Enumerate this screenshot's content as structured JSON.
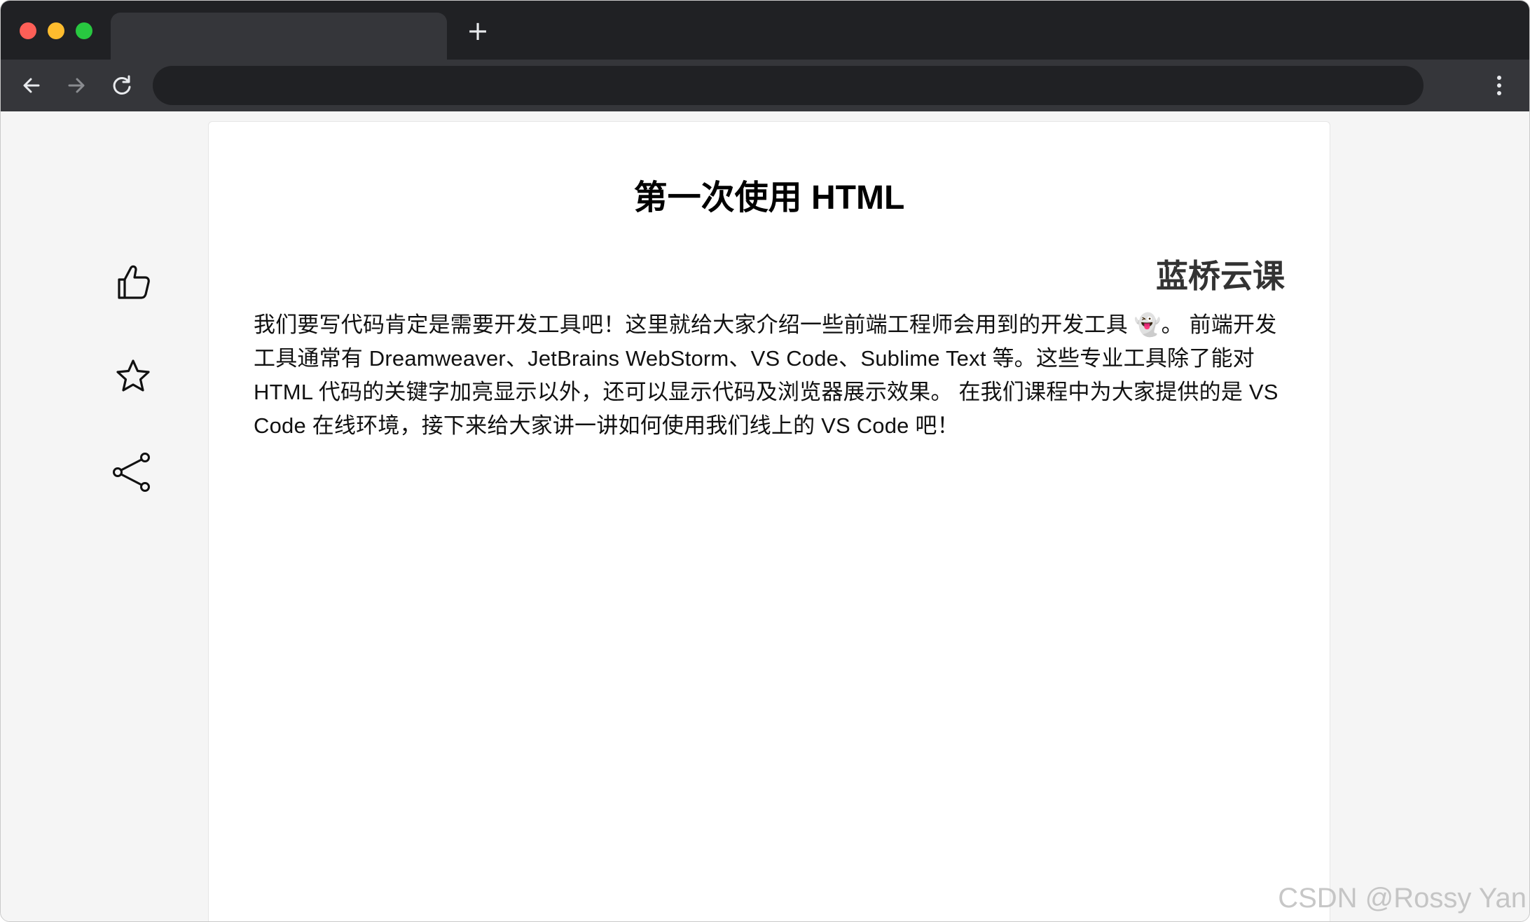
{
  "browser": {
    "new_tab_label": "+",
    "icons": {
      "back": "arrow-left-icon",
      "forward": "arrow-right-icon",
      "reload": "reload-icon",
      "menu": "more-vertical-icon"
    },
    "colors": {
      "tabbar": "#202124",
      "toolbar": "#35363a",
      "close": "#fe5f57",
      "minimize": "#febc2e",
      "maximize": "#28c840"
    }
  },
  "side_actions": [
    {
      "name": "like",
      "icon": "thumbs-up-icon"
    },
    {
      "name": "favorite",
      "icon": "star-icon"
    },
    {
      "name": "share",
      "icon": "share-icon"
    }
  ],
  "article": {
    "title": "第一次使用 HTML",
    "subtitle": "蓝桥云课",
    "body": "我们要写代码肯定是需要开发工具吧！这里就给大家介绍一些前端工程师会用到的开发工具 👻。 前端开发工具通常有 Dreamweaver、JetBrains WebStorm、VS Code、Sublime Text 等。这些专业工具除了能对 HTML 代码的关键字加亮显示以外，还可以显示代码及浏览器展示效果。 在我们课程中为大家提供的是 VS Code 在线环境，接下来给大家讲一讲如何使用我们线上的 VS Code 吧！"
  },
  "watermark": "CSDN @Rossy Yan"
}
